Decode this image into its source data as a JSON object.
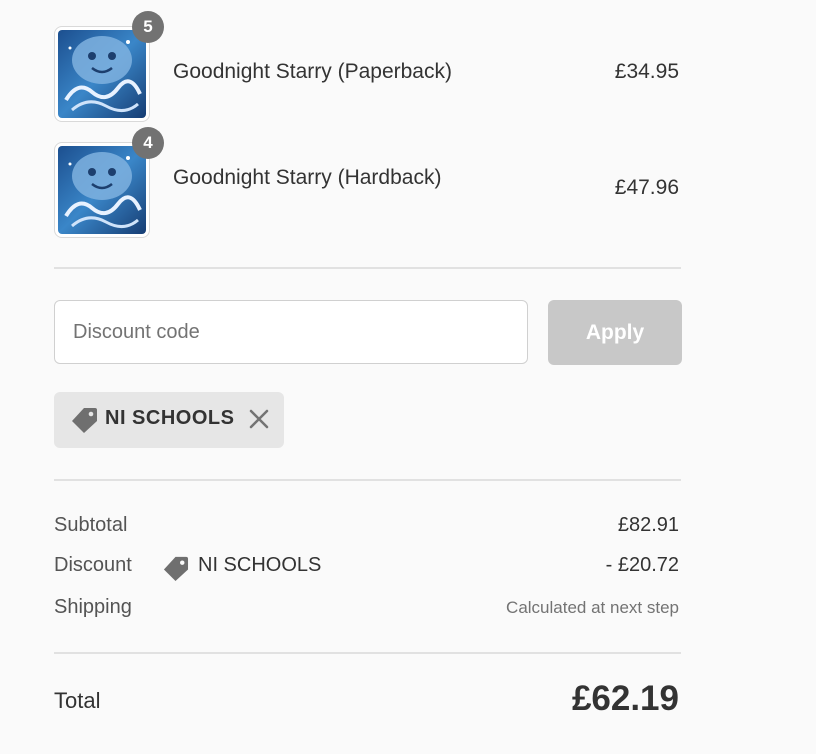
{
  "products": [
    {
      "name": "Goodnight Starry (Paperback)",
      "quantity": "5",
      "price": "£34.95",
      "thumbnail_icon": "book-cover-image"
    },
    {
      "name": "Goodnight Starry (Hardback)",
      "quantity": "4",
      "price": "£47.96",
      "thumbnail_icon": "book-cover-image"
    }
  ],
  "discount": {
    "placeholder": "Discount code",
    "apply_label": "Apply",
    "applied_code": "NI SCHOOLS",
    "tag_icon": "tag-icon",
    "remove_icon": "close-icon"
  },
  "totals": {
    "subtotal_label": "Subtotal",
    "subtotal_value": "£82.91",
    "discount_label": "Discount",
    "discount_code": "NI SCHOOLS",
    "discount_value": "- £20.72",
    "shipping_label": "Shipping",
    "shipping_value": "Calculated at next step",
    "total_label": "Total",
    "total_value": "£62.19"
  },
  "colors": {
    "background": "#fafafa",
    "badge": "#727272",
    "apply_disabled": "#c8c8c8",
    "chip_background": "#e6e6e6",
    "cover_blue": "#2a6fb3"
  }
}
